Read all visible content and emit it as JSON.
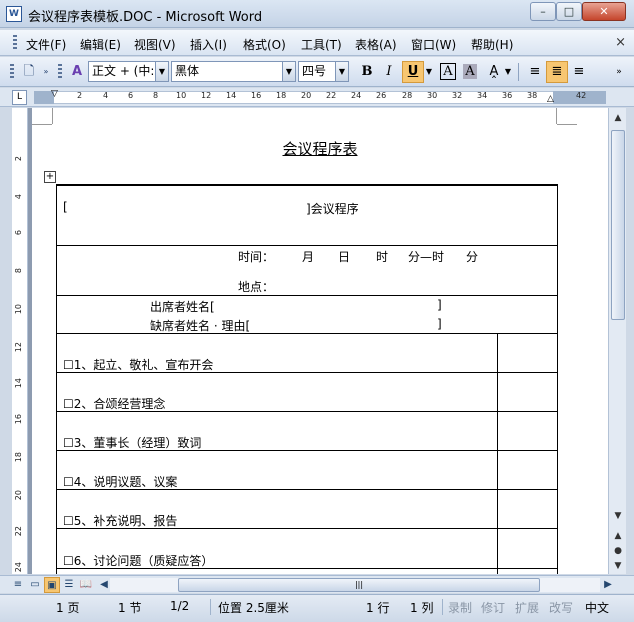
{
  "window": {
    "title": "会议程序表模板.DOC - Microsoft Word",
    "minimize": "–",
    "maximize": "□",
    "close": "✕"
  },
  "menu": {
    "items": [
      "文件(F)",
      "编辑(E)",
      "视图(V)",
      "插入(I)",
      "格式(O)",
      "工具(T)",
      "表格(A)",
      "窗口(W)",
      "帮助(H)"
    ],
    "close_doc": "×"
  },
  "toolbar": {
    "style": "正文 + (中:",
    "font": "黑体",
    "size": "四号",
    "bold": "B",
    "italic": "I",
    "underline": "U",
    "char_border": "A",
    "char_shading": "A"
  },
  "ruler": {
    "ticks": [
      "2",
      "4",
      "6",
      "8",
      "10",
      "12",
      "14",
      "16",
      "18",
      "20",
      "22",
      "24",
      "26",
      "28",
      "30",
      "32",
      "34",
      "36",
      "38",
      "42"
    ],
    "vticks": [
      "2",
      "4",
      "6",
      "8",
      "10",
      "12",
      "14",
      "16",
      "18",
      "20",
      "22",
      "24"
    ]
  },
  "document": {
    "title": "会议程序表",
    "row1_left": "[",
    "row1_right": "]会议程序",
    "time_label": "时间：",
    "month": "月",
    "day": "日",
    "hour": "时",
    "minute_dash": "分—时",
    "minute": "分",
    "place_label": "地点：",
    "attendees": "出席者姓名[",
    "attendees_end": "]",
    "absentees": "缺席者姓名 · 理由[",
    "absentees_end": "]",
    "agenda": [
      "☐1、起立、敬礼、宣布开会",
      "☐2、合颂经营理念",
      "☐3、董事长（经理）致词",
      "☐4、说明议题、议案",
      "☐5、补充说明、报告",
      "☐6、讨论问题（质疑应答）"
    ]
  },
  "status": {
    "page": "1 页",
    "section": "1 节",
    "pages": "1/2",
    "position": "位置 2.5厘米",
    "line": "1 行",
    "col": "1 列",
    "rec": "录制",
    "trk": "修订",
    "ext": "扩展",
    "ovr": "改写",
    "lang": "中文"
  }
}
